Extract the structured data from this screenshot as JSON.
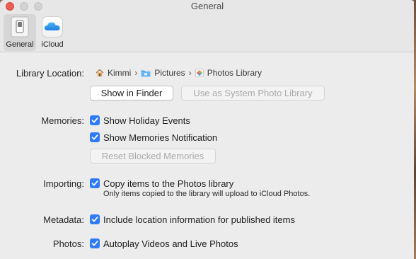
{
  "window": {
    "title": "General",
    "controls": [
      "close",
      "minimize",
      "zoom"
    ]
  },
  "toolbar": {
    "tabs": [
      {
        "label": "General",
        "icon": "general-switch-icon",
        "selected": true
      },
      {
        "label": "iCloud",
        "icon": "icloud-icon",
        "selected": false
      }
    ]
  },
  "library": {
    "label": "Library Location:",
    "path": [
      {
        "label": "Kimmi",
        "icon": "home-icon"
      },
      {
        "label": "Pictures",
        "icon": "folder-icon"
      },
      {
        "label": "Photos Library",
        "icon": "photos-library-icon"
      }
    ],
    "show_in_finder": "Show in Finder",
    "use_as_system": "Use as System Photo Library"
  },
  "memories": {
    "label": "Memories:",
    "show_holiday": "Show Holiday Events",
    "show_notifications": "Show Memories Notification",
    "reset_blocked": "Reset Blocked Memories"
  },
  "importing": {
    "label": "Importing:",
    "copy_items": "Copy items to the Photos library",
    "note": "Only items copied to the library will upload to iCloud Photos."
  },
  "metadata": {
    "label": "Metadata:",
    "include_location": "Include location information for published items"
  },
  "photos": {
    "label": "Photos:",
    "autoplay": "Autoplay Videos and Live Photos"
  },
  "colors": {
    "accent": "#2f7bf5",
    "close": "#ec5f57",
    "window_bg": "#ececec"
  }
}
